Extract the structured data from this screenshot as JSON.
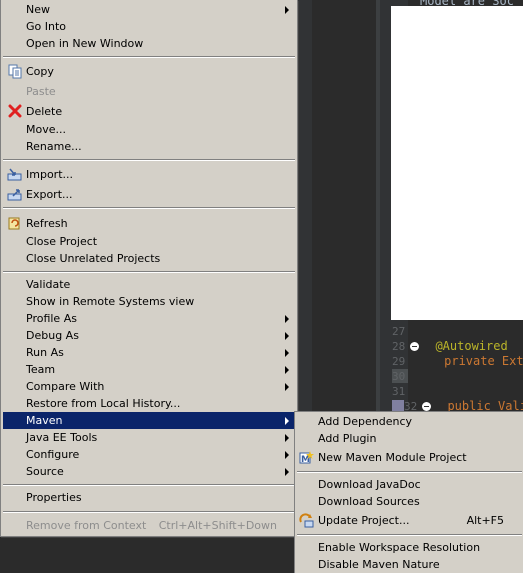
{
  "editor": {
    "top_fragment": "Model are Soc",
    "lines": [
      {
        "num": "27",
        "code": "",
        "fold": false,
        "highlight": false
      },
      {
        "num": "28",
        "code": "@Autowired",
        "fold": true,
        "highlight": false
      },
      {
        "num": "29",
        "code": "private Ext",
        "fold": false,
        "highlight": false
      },
      {
        "num": "30",
        "code": "",
        "fold": false,
        "highlight": true
      },
      {
        "num": "31",
        "code": "",
        "fold": false,
        "highlight": false
      },
      {
        "num": "32",
        "code": "public Vali",
        "fold": true,
        "highlight": false
      }
    ]
  },
  "context_menu": {
    "items": [
      {
        "label": "New",
        "submenu": true
      },
      {
        "label": "Go Into"
      },
      {
        "label": "Open in New Window"
      },
      {
        "label": "Copy",
        "icon": "copy-icon"
      },
      {
        "label": "Paste",
        "disabled": true,
        "icon": "paste-icon"
      },
      {
        "label": "Delete",
        "icon": "delete-icon"
      },
      {
        "label": "Move..."
      },
      {
        "label": "Rename..."
      },
      {
        "label": "Import...",
        "icon": "import-icon"
      },
      {
        "label": "Export...",
        "icon": "export-icon"
      },
      {
        "label": "Refresh",
        "icon": "refresh-icon"
      },
      {
        "label": "Close Project"
      },
      {
        "label": "Close Unrelated Projects"
      },
      {
        "label": "Validate"
      },
      {
        "label": "Show in Remote Systems view"
      },
      {
        "label": "Profile As",
        "submenu": true
      },
      {
        "label": "Debug As",
        "submenu": true
      },
      {
        "label": "Run As",
        "submenu": true
      },
      {
        "label": "Team",
        "submenu": true
      },
      {
        "label": "Compare With",
        "submenu": true
      },
      {
        "label": "Restore from Local History..."
      },
      {
        "label": "Maven",
        "submenu": true,
        "selected": true
      },
      {
        "label": "Java EE Tools",
        "submenu": true
      },
      {
        "label": "Configure",
        "submenu": true
      },
      {
        "label": "Source",
        "submenu": true
      },
      {
        "label": "Properties"
      },
      {
        "label": "Remove from Context",
        "accel": "Ctrl+Alt+Shift+Down",
        "disabled": true
      }
    ]
  },
  "maven_submenu": {
    "items": [
      {
        "label": "Add Dependency"
      },
      {
        "label": "Add Plugin"
      },
      {
        "label": "New Maven Module Project",
        "icon": "maven-module-icon"
      },
      {
        "label": "Download JavaDoc"
      },
      {
        "label": "Download Sources"
      },
      {
        "label": "Update Project...",
        "accel": "Alt+F5",
        "icon": "update-project-icon"
      },
      {
        "label": "Enable Workspace Resolution"
      },
      {
        "label": "Disable Maven Nature"
      }
    ]
  },
  "colors": {
    "menu_bg": "#d4d0c8",
    "selection": "#0a246a",
    "disabled_text": "#8d8d8d",
    "editor_bg": "#2b2b2b"
  }
}
